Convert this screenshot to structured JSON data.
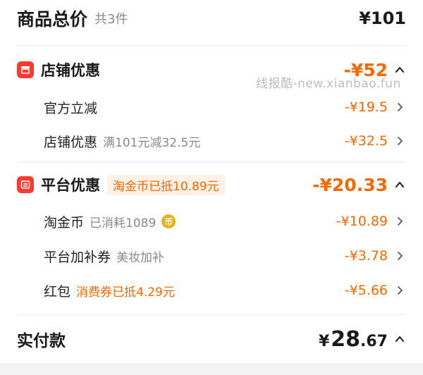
{
  "header": {
    "title": "商品总价",
    "count": "共3件",
    "total": "¥101"
  },
  "store_discount": {
    "title": "店铺优惠",
    "amount": "-¥52",
    "items": [
      {
        "label": "官方立减",
        "note": "",
        "amount": "-¥19.5"
      },
      {
        "label": "店铺优惠",
        "note": "满101元减32.5元",
        "amount": "-¥32.5"
      }
    ]
  },
  "watermark": "线报酷-new.xianbao.fun",
  "platform_discount": {
    "title": "平台优惠",
    "tag": "淘金币已抵10.89元",
    "amount": "-¥20.33",
    "items": [
      {
        "label": "淘金币",
        "note": "已消耗1089",
        "coin_glyph": "币",
        "amount": "-¥10.89"
      },
      {
        "label": "平台加补券",
        "note": "美妆加补",
        "amount": "-¥3.78"
      },
      {
        "label": "红包",
        "note": "消费券已抵4.29元",
        "amount": "-¥5.66"
      }
    ]
  },
  "payment": {
    "label": "实付款",
    "currency": "¥",
    "integer": "28",
    "decimal": ".67"
  },
  "colors": {
    "accent_orange": "#f56a00",
    "icon_red": "#ff3b30",
    "coin_gold": "#e9b022",
    "tag_bg": "#fff1e6"
  },
  "icons": {
    "store": "store-icon",
    "platform": "platform-icon",
    "chevron_up": "chevron-up-icon",
    "chevron_right": "chevron-right-icon",
    "coin": "coin-icon"
  }
}
